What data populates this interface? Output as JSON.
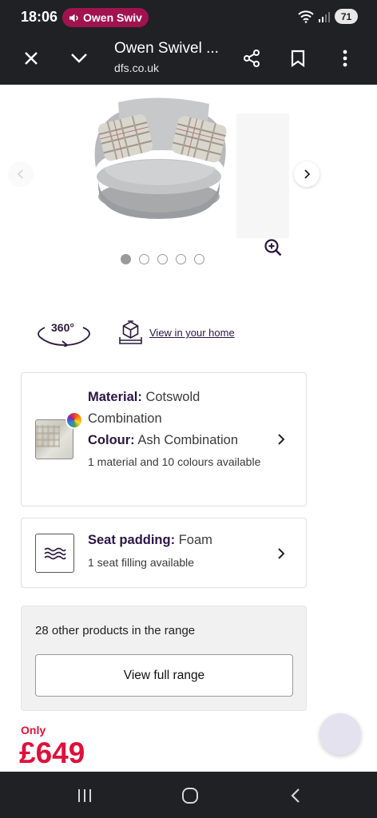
{
  "status_bar": {
    "time": "18:06",
    "media_label": "Owen Swiv",
    "battery": "71",
    "icons": [
      "speaker-icon",
      "wifi-icon",
      "signal-icon",
      "battery-icon"
    ]
  },
  "browser": {
    "tab_title": "Owen Swivel ...",
    "url": "dfs.co.uk",
    "icons": [
      "close-icon",
      "chevron-down-icon",
      "share-icon",
      "bookmark-icon",
      "more-vert-icon"
    ]
  },
  "gallery": {
    "image_subject": "grey swivel cuddle chair with checked scatter cushions",
    "dot_count": 5,
    "active_dot": 0,
    "icons": [
      "chevron-left-icon",
      "chevron-right-icon",
      "zoom-in-icon"
    ]
  },
  "features": {
    "view_360_label": "360°",
    "view_in_home_label": "View in your home"
  },
  "material_card": {
    "material_label": "Material:",
    "material_value": "Cotswold Combination",
    "colour_label": "Colour:",
    "colour_value": "Ash Combination",
    "availability": "1 material and 10 colours available"
  },
  "seat_card": {
    "label": "Seat padding:",
    "value": "Foam",
    "sub": "1 seat filling available"
  },
  "range_card": {
    "text": "28 other products in the range",
    "button_label": "View full range"
  },
  "price": {
    "prefix": "Only",
    "value": "£649"
  },
  "colors": {
    "accent": "#2b1545",
    "price": "#e0103a",
    "toolbar": "#202124",
    "media_pill": "#a0134f"
  }
}
